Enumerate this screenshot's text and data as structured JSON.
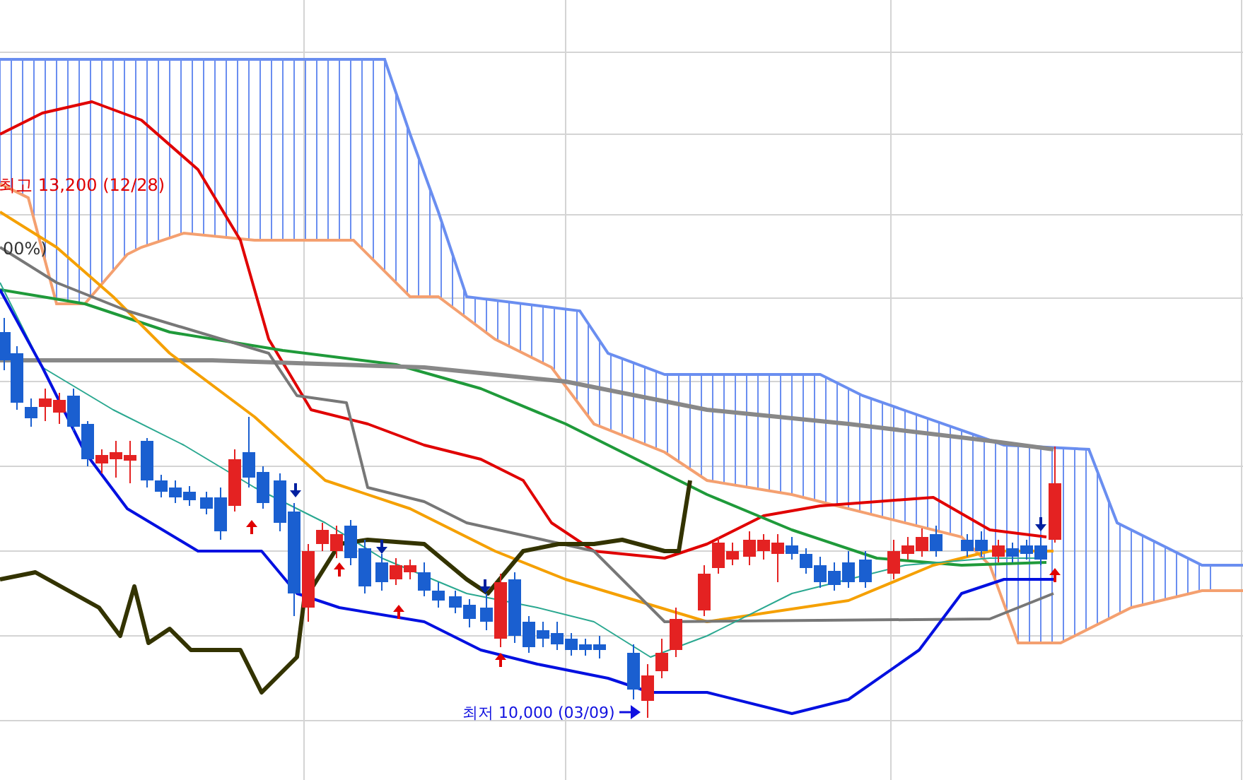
{
  "chart": {
    "high_label": "최고 13,200 (12/28)",
    "partial_label": "00%)",
    "low_label": "최저 10,000 (03/09)"
  }
}
